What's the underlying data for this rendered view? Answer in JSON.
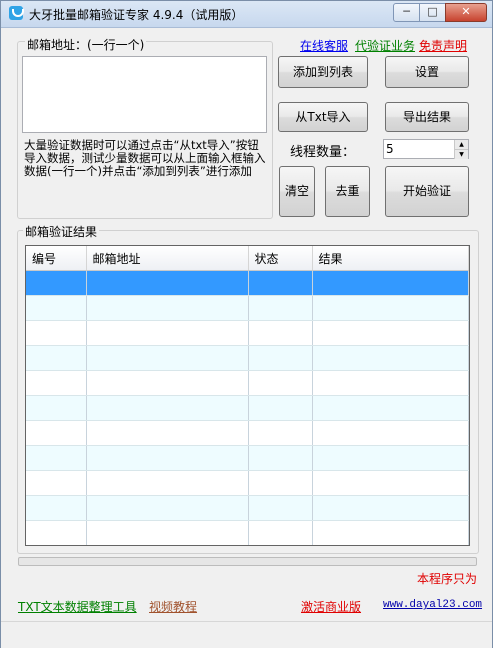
{
  "window": {
    "title": "大牙批量邮箱验证专家 4.9.4（试用版）"
  },
  "links": {
    "online_service": "在线客服",
    "proxy_service": "代验证业务",
    "disclaimer": "免责声明"
  },
  "input_group": {
    "label": "邮箱地址：(一行一个)",
    "hint": "大量验证数据时可以通过点击“从txt导入”按钮导入数据，测试少量数据可以从上面输入框输入数据(一行一个)并点击“添加到列表”进行添加"
  },
  "buttons": {
    "add_to_list": "添加到列表",
    "settings": "设置",
    "import_txt": "从Txt导入",
    "export": "导出结果",
    "clear": "清空",
    "dedupe": "去重",
    "start": "开始验证"
  },
  "threads": {
    "label": "线程数量：",
    "value": "5"
  },
  "results": {
    "label": "邮箱验证结果",
    "columns": [
      "编号",
      "邮箱地址",
      "状态",
      "结果"
    ]
  },
  "footer": {
    "notice": "本程序只为",
    "txt_tool": "TXT文本数据整理工具",
    "video": "视频教程",
    "activate": "激活商业版",
    "website": "www.dayal23.com"
  },
  "colors": {
    "link_blue": "#0000ee",
    "link_green": "#008000",
    "link_red": "#e00000",
    "selection": "#3399ff",
    "row_alt": "#eefcff"
  }
}
